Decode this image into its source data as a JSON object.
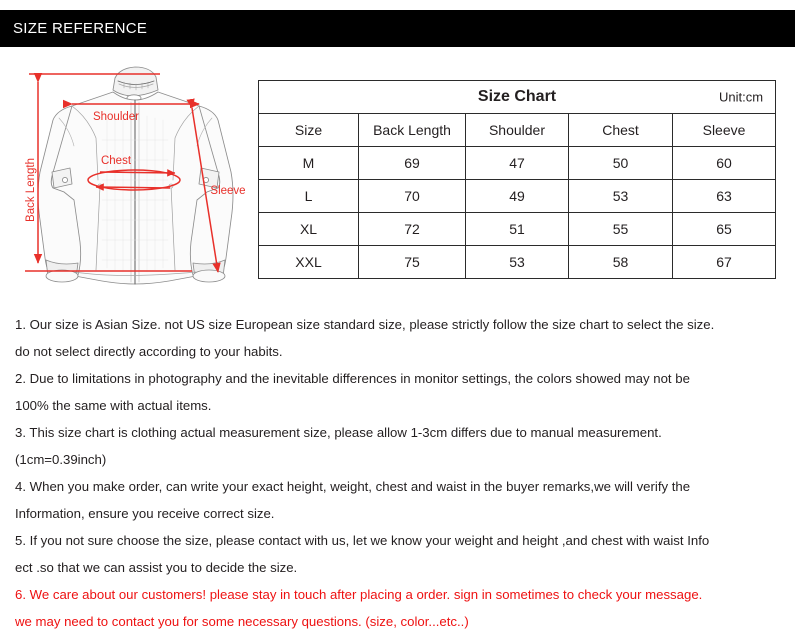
{
  "header": {
    "title": "SIZE REFERENCE",
    "background_color": "#000000",
    "text_color": "#ffffff"
  },
  "diagram": {
    "name": "jacket-measurement-diagram",
    "annotation_color": "#e8302a",
    "labels": {
      "back_length": "Back Length",
      "shoulder": "Shoulder",
      "chest": "Chest",
      "sleeve": "Sleeve"
    }
  },
  "size_chart": {
    "title": "Size Chart",
    "unit": "Unit:cm",
    "columns": [
      "Size",
      "Back Length",
      "Shoulder",
      "Chest",
      "Sleeve"
    ],
    "rows": [
      {
        "size": "M",
        "back_length": "69",
        "shoulder": "47",
        "chest": "50",
        "sleeve": "60"
      },
      {
        "size": "L",
        "back_length": "70",
        "shoulder": "49",
        "chest": "53",
        "sleeve": "63"
      },
      {
        "size": "XL",
        "back_length": "72",
        "shoulder": "51",
        "chest": "55",
        "sleeve": "65"
      },
      {
        "size": "XXL",
        "back_length": "75",
        "shoulder": "53",
        "chest": "58",
        "sleeve": "67"
      }
    ]
  },
  "notes": {
    "red_color": "#ee1111",
    "lines": [
      {
        "text": "1. Our size is Asian Size. not US size European size standard size, please strictly follow the size chart to select the size.",
        "red": false
      },
      {
        "text": "do not select directly according to your habits.",
        "red": false
      },
      {
        "text": "2. Due to limitations in photography and the inevitable differences in monitor settings, the colors showed may not be",
        "red": false
      },
      {
        "text": "100% the same with actual items.",
        "red": false
      },
      {
        "text": "3. This size chart is clothing actual measurement size, please allow 1-3cm differs due to manual measurement.",
        "red": false
      },
      {
        "text": "(1cm=0.39inch)",
        "red": false
      },
      {
        "text": "4. When you make order, can write your exact height, weight, chest and waist in the buyer remarks,we will verify the",
        "red": false
      },
      {
        "text": "Information, ensure you receive correct size.",
        "red": false
      },
      {
        "text": "5. If you not sure choose the size, please contact with us, let we know your weight and height ,and chest with waist Info",
        "red": false
      },
      {
        "text": "ect .so that we can assist you to decide the size.",
        "red": false
      },
      {
        "text": "6. We care about our customers! please stay in touch after placing a order. sign in sometimes to check your message.",
        "red": true
      },
      {
        "text": "we may need to contact you for some necessary questions. (size, color...etc..)",
        "red": true
      }
    ]
  }
}
